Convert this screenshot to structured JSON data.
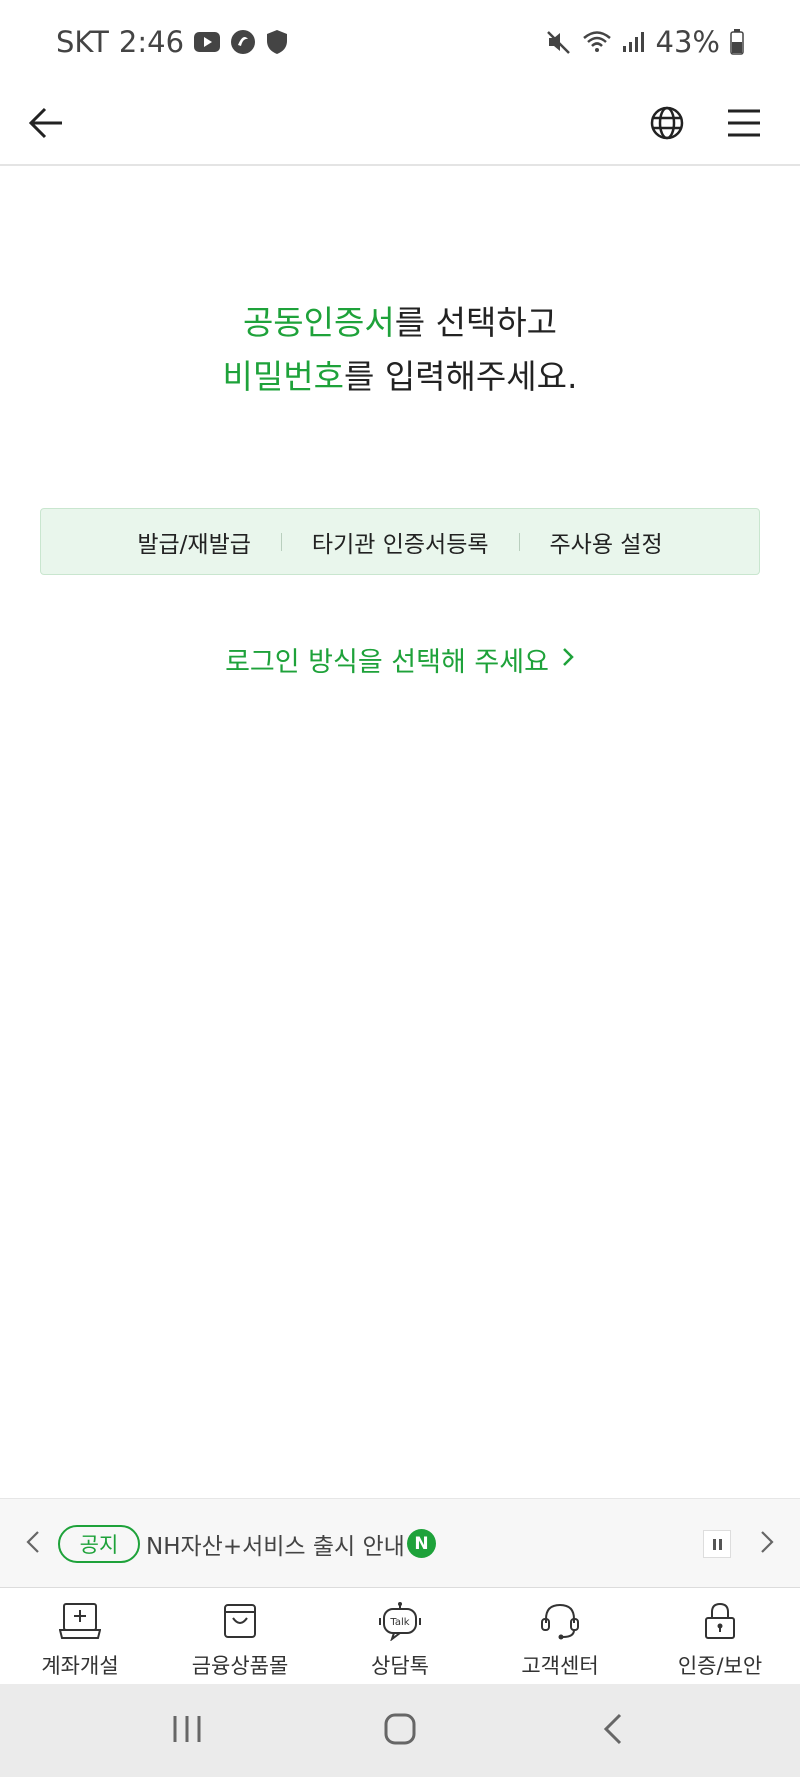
{
  "status_bar": {
    "carrier": "SKT",
    "time": "2:46",
    "battery": "43%"
  },
  "header": {
    "back_icon": "arrow-left-icon",
    "language_icon": "globe-icon",
    "menu_icon": "hamburger-icon"
  },
  "headline": {
    "line1_highlight": "공동인증서",
    "line1_rest": "를 선택하고",
    "line2_highlight": "비밀번호",
    "line2_rest": "를 입력해주세요."
  },
  "actions": [
    {
      "label": "발급/재발급"
    },
    {
      "label": "타기관 인증서등록"
    },
    {
      "label": "주사용 설정"
    }
  ],
  "login_method": {
    "label": "로그인 방식을 선택해 주세요"
  },
  "notice": {
    "badge": "공지",
    "text": "NH자산+서비스 출시 안내",
    "new_badge": "N"
  },
  "tabs": [
    {
      "label": "계좌개설",
      "icon": "account-open-icon"
    },
    {
      "label": "금융상품몰",
      "icon": "shopping-bag-icon"
    },
    {
      "label": "상담톡",
      "icon": "talk-icon",
      "icon_text": "Talk"
    },
    {
      "label": "고객센터",
      "icon": "headset-icon"
    },
    {
      "label": "인증/보안",
      "icon": "lock-icon"
    }
  ],
  "colors": {
    "accent": "#1ea23a",
    "action_bg": "#e9f6ec",
    "notice_bg": "#f7f7f7",
    "nav_bg": "#ebebeb"
  }
}
